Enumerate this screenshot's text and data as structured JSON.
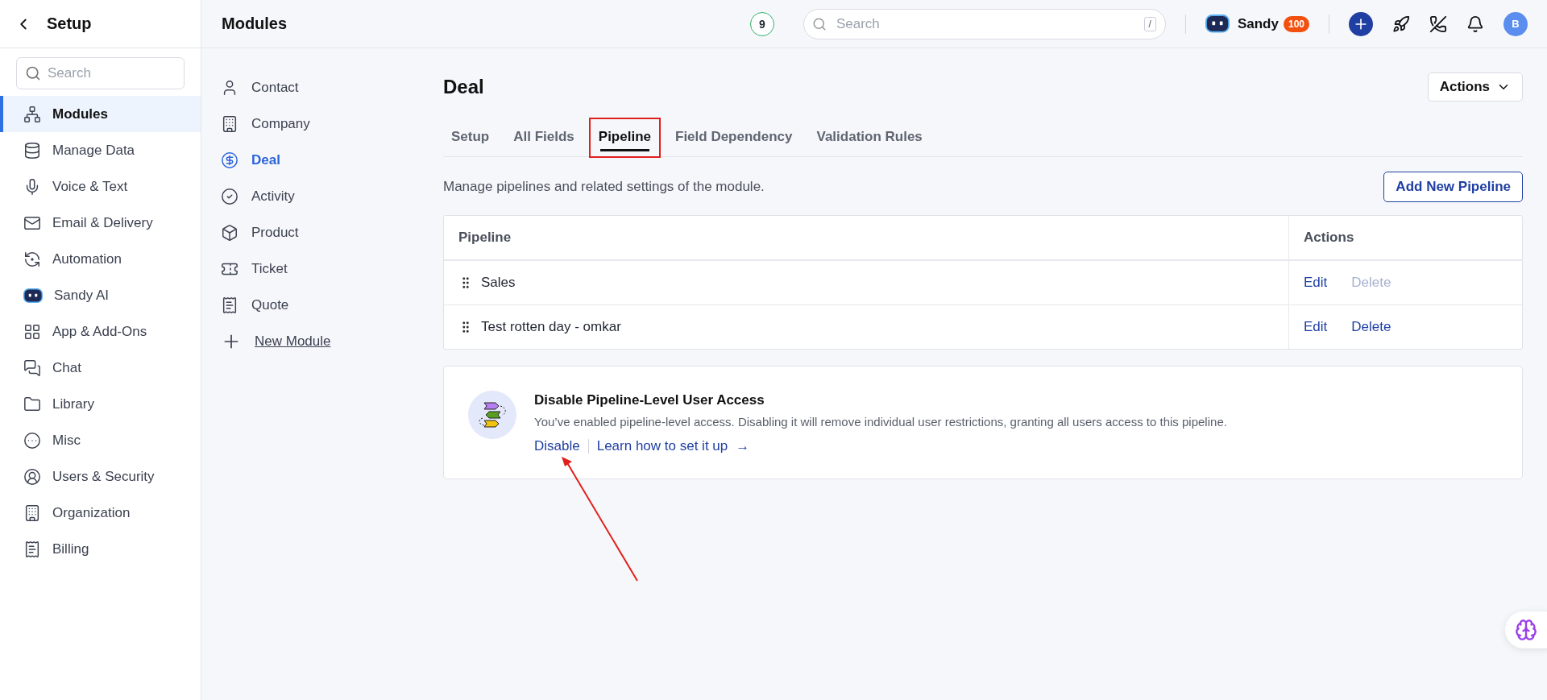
{
  "sidebar": {
    "back_title": "Setup",
    "search": {
      "placeholder": "Search"
    },
    "items": [
      {
        "label": "Modules",
        "selected": true
      },
      {
        "label": "Manage Data",
        "selected": false
      },
      {
        "label": "Voice & Text",
        "selected": false
      },
      {
        "label": "Email & Delivery",
        "selected": false
      },
      {
        "label": "Automation",
        "selected": false
      },
      {
        "label": "Sandy AI",
        "selected": false
      },
      {
        "label": "App & Add-Ons",
        "selected": false
      },
      {
        "label": "Chat",
        "selected": false
      },
      {
        "label": "Library",
        "selected": false
      },
      {
        "label": "Misc",
        "selected": false
      },
      {
        "label": "Users & Security",
        "selected": false
      },
      {
        "label": "Organization",
        "selected": false
      },
      {
        "label": "Billing",
        "selected": false
      }
    ]
  },
  "header": {
    "title": "Modules",
    "badge": "9",
    "search": {
      "placeholder": "Search",
      "shortcut": "/"
    },
    "assistant": {
      "name": "Sandy",
      "count": "100"
    },
    "avatar": "B"
  },
  "modules_nav": [
    {
      "label": "Contact",
      "selected": false,
      "kind": "item"
    },
    {
      "label": "Company",
      "selected": false,
      "kind": "item"
    },
    {
      "label": "Deal",
      "selected": true,
      "kind": "item"
    },
    {
      "label": "Activity",
      "selected": false,
      "kind": "item"
    },
    {
      "label": "Product",
      "selected": false,
      "kind": "item"
    },
    {
      "label": "Ticket",
      "selected": false,
      "kind": "item"
    },
    {
      "label": "Quote",
      "selected": false,
      "kind": "item"
    },
    {
      "label": "New Module",
      "selected": false,
      "kind": "link"
    }
  ],
  "page": {
    "title": "Deal",
    "actions_button": "Actions",
    "tabs": [
      {
        "label": "Setup",
        "selected": false,
        "highlighted": false
      },
      {
        "label": "All Fields",
        "selected": false,
        "highlighted": false
      },
      {
        "label": "Pipeline",
        "selected": true,
        "highlighted": true
      },
      {
        "label": "Field Dependency",
        "selected": false,
        "highlighted": false
      },
      {
        "label": "Validation Rules",
        "selected": false,
        "highlighted": false
      }
    ],
    "description": "Manage pipelines and related settings of the module.",
    "add_button": "Add New Pipeline",
    "table": {
      "columns": [
        "Pipeline",
        "Actions"
      ],
      "rows": [
        {
          "name": "Sales",
          "edit": "Edit",
          "delete": "Delete",
          "delete_disabled": true
        },
        {
          "name": "Test rotten day - omkar",
          "edit": "Edit",
          "delete": "Delete",
          "delete_disabled": false
        }
      ]
    },
    "notice": {
      "title": "Disable Pipeline-Level User Access",
      "text": "You’ve enabled pipeline-level access. Disabling it will remove individual user restrictions, granting all users access to this pipeline.",
      "action": "Disable",
      "link": "Learn how to set it up",
      "arrow": "→",
      "annotated": true
    }
  }
}
